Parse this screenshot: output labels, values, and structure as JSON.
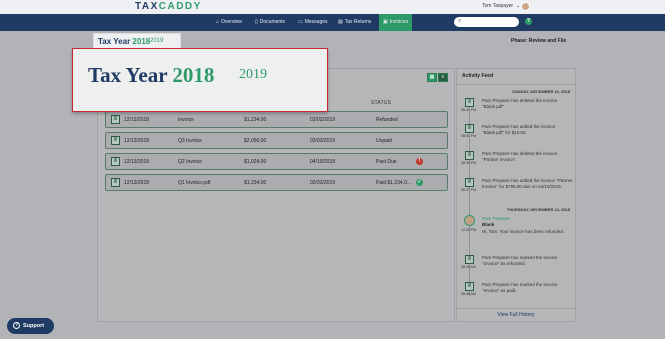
{
  "header": {
    "logo_a": "TAX",
    "logo_b": "CADDY",
    "user_name": "Tom Taxpayer",
    "user_chevron": "chevron-down-icon"
  },
  "nav": {
    "items": [
      {
        "label": "Overview",
        "icon": "home-icon"
      },
      {
        "label": "Documents",
        "icon": "document-icon"
      },
      {
        "label": "Messages",
        "icon": "chat-icon"
      },
      {
        "label": "Tax Returns",
        "icon": "return-icon"
      },
      {
        "label": "Invoices",
        "icon": "invoice-icon",
        "active": true
      }
    ],
    "search_icon": "search-icon",
    "help_label": "?"
  },
  "page": {
    "phase": "Phase: Review and File",
    "year_small": {
      "label": "Tax Year",
      "selected": "2018",
      "other": "2019"
    },
    "year_zoom": {
      "label": "Tax Year",
      "selected": "2018",
      "other": "2019"
    }
  },
  "invoices": {
    "status_header": "STATUS",
    "rows": [
      {
        "date": "12/13/2018",
        "name": "Invoice",
        "amount": "$1,234.00",
        "date2": "02/03/2019",
        "status": "Refunded",
        "badge": ""
      },
      {
        "date": "12/13/2018",
        "name": "Q3 Invoice",
        "amount": "$2,056.00",
        "date2": "02/03/2019",
        "status": "Unpaid",
        "badge": ""
      },
      {
        "date": "12/13/2018",
        "name": "Q2 Invoice",
        "amount": "$1,024.00",
        "date2": "04/10/2018",
        "status": "Past Due",
        "badge": "!"
      },
      {
        "date": "12/13/2018",
        "name": "Q1 Invoice.pdf",
        "amount": "$1,234.00",
        "date2": "02/03/2019",
        "status": "Paid $1,234.0...",
        "badge": "✓"
      }
    ]
  },
  "feed": {
    "title": "Activity Feed",
    "day1": "SUNDAY, DECEMBER 16, 2018",
    "day2": "THURSDAY, DECEMBER 13, 2018",
    "events": [
      {
        "time": "08:41 PM",
        "text": "Pam Preparer has deleted the invoice \"Blank.pdf\"."
      },
      {
        "time": "08:41 PM",
        "text": "Pam Preparer has added the invoice \"Blank.pdf\" for $10.00."
      },
      {
        "time": "08:38 PM",
        "text": "Pam Preparer has deleted the invoice \"Partner Invoice\"."
      },
      {
        "time": "08:37 PM",
        "text": "Pam Preparer has added the invoice \"Partner Invoice\" for $795.00 due on 04/10/2019."
      },
      {
        "time": "12:26 PM",
        "name": "Pam Preparer",
        "subject": "Blank",
        "text": "Hi, Tom. Your invoice has been refunded."
      },
      {
        "time": "08:46 AM",
        "text": "Pam Preparer has marked the invoice \"Invoice\" as refunded."
      },
      {
        "time": "08:46 AM",
        "text": "Pam Preparer has marked the invoice \"Invoice\" as paid."
      }
    ],
    "view_all": "View Full History"
  },
  "support": {
    "label": "Support",
    "icon": "question-icon"
  },
  "colors": {
    "navy": "#1f3b63",
    "green": "#2f9a69",
    "red": "#c1272d"
  }
}
